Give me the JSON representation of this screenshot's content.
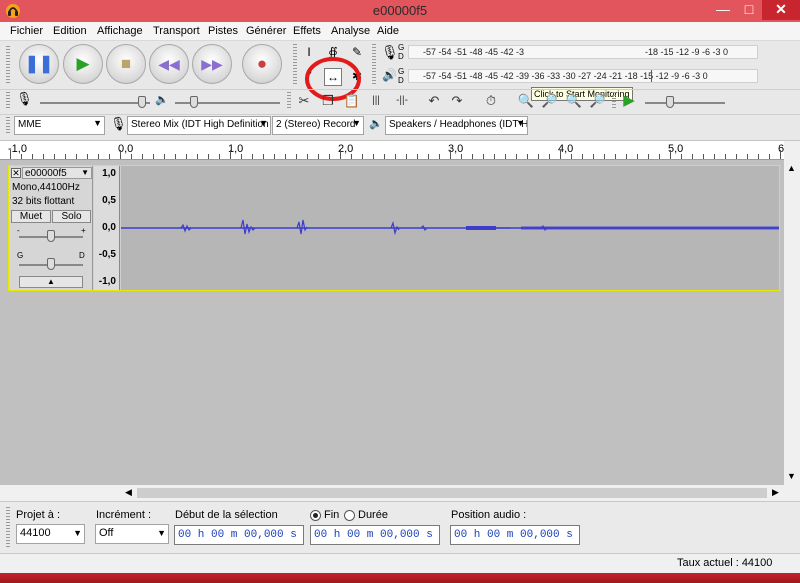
{
  "window": {
    "title": "e00000f5"
  },
  "menu": [
    "Fichier",
    "Edition",
    "Affichage",
    "Transport",
    "Pistes",
    "Générer",
    "Effets",
    "Analyse",
    "Aide"
  ],
  "meters": {
    "record_ticks": "-57 -54 -51 -48 -45 -42 -3",
    "record_ticks_right": "-18 -15 -12 -9 -6 -3 0",
    "monitor_tip": "Click to Start Monitoring",
    "play_ticks": "-57 -54 -51 -48 -45 -42 -39 -36 -33 -30 -27 -24 -21 -18 -15 -12 -9 -6 -3 0",
    "record_channel_top": "G",
    "record_channel_bottom": "D"
  },
  "device": {
    "host": "MME",
    "input": "Stereo Mix (IDT High Definition",
    "channels": "2 (Stereo) Record",
    "output": "Speakers / Headphones (IDT H"
  },
  "ruler": {
    "labels": [
      "-1,0",
      "0,0",
      "1,0",
      "2,0",
      "3,0",
      "4,0",
      "5,0",
      "6,0"
    ],
    "values": [
      -1.0,
      0.0,
      1.0,
      2.0,
      3.0,
      4.0,
      5.0,
      6.0
    ]
  },
  "track": {
    "name": "e00000f5",
    "info1": "Mono,44100Hz",
    "info2": "32 bits flottant",
    "mute": "Muet",
    "solo": "Solo",
    "gain_left": "G",
    "gain_right": "D",
    "scale": [
      "1,0",
      "0,5",
      "0,0",
      "-0,5",
      "-1,0"
    ]
  },
  "selection_toolbar": {
    "rate_label": "Projet à :",
    "rate_value": "44100",
    "snap_label": "Incrément :",
    "snap_value": "Off",
    "start_label": "Début de la sélection",
    "end_label": "Fin",
    "length_label": "Durée",
    "audio_pos_label": "Position audio :",
    "time_value": "00 h 00 m 00,000 s"
  },
  "status": {
    "rate": "Taux actuel : 44100"
  }
}
